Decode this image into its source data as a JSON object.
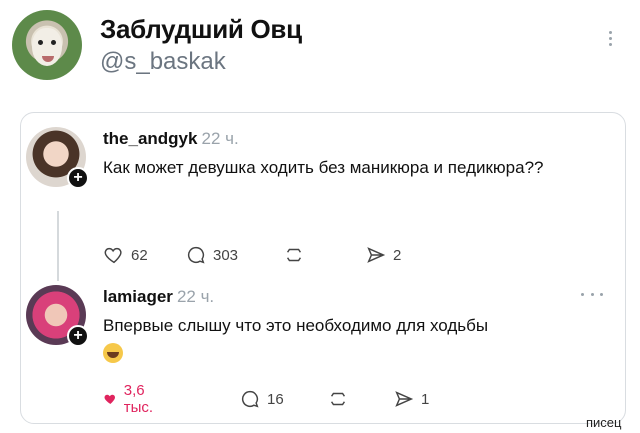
{
  "header": {
    "display_name": "Заблудший Овц",
    "handle": "@s_baskak"
  },
  "posts": [
    {
      "username": "the_andgyk",
      "time": "22 ч.",
      "text": "Как может девушка ходить без маникюра и педикюра??",
      "likes": "62",
      "replies": "303",
      "reposts": "",
      "shares": "2",
      "liked": false
    },
    {
      "username": "lamiager",
      "time": "22 ч.",
      "text": "Впервые слышу что это необходимо для ходьбы",
      "likes": "3,6 тыс.",
      "replies": "16",
      "reposts": "",
      "shares": "1",
      "liked": true
    }
  ],
  "watermark": "писец",
  "colors": {
    "like_active": "#e0245e",
    "muted": "#9aa3ab",
    "text": "#111111"
  }
}
